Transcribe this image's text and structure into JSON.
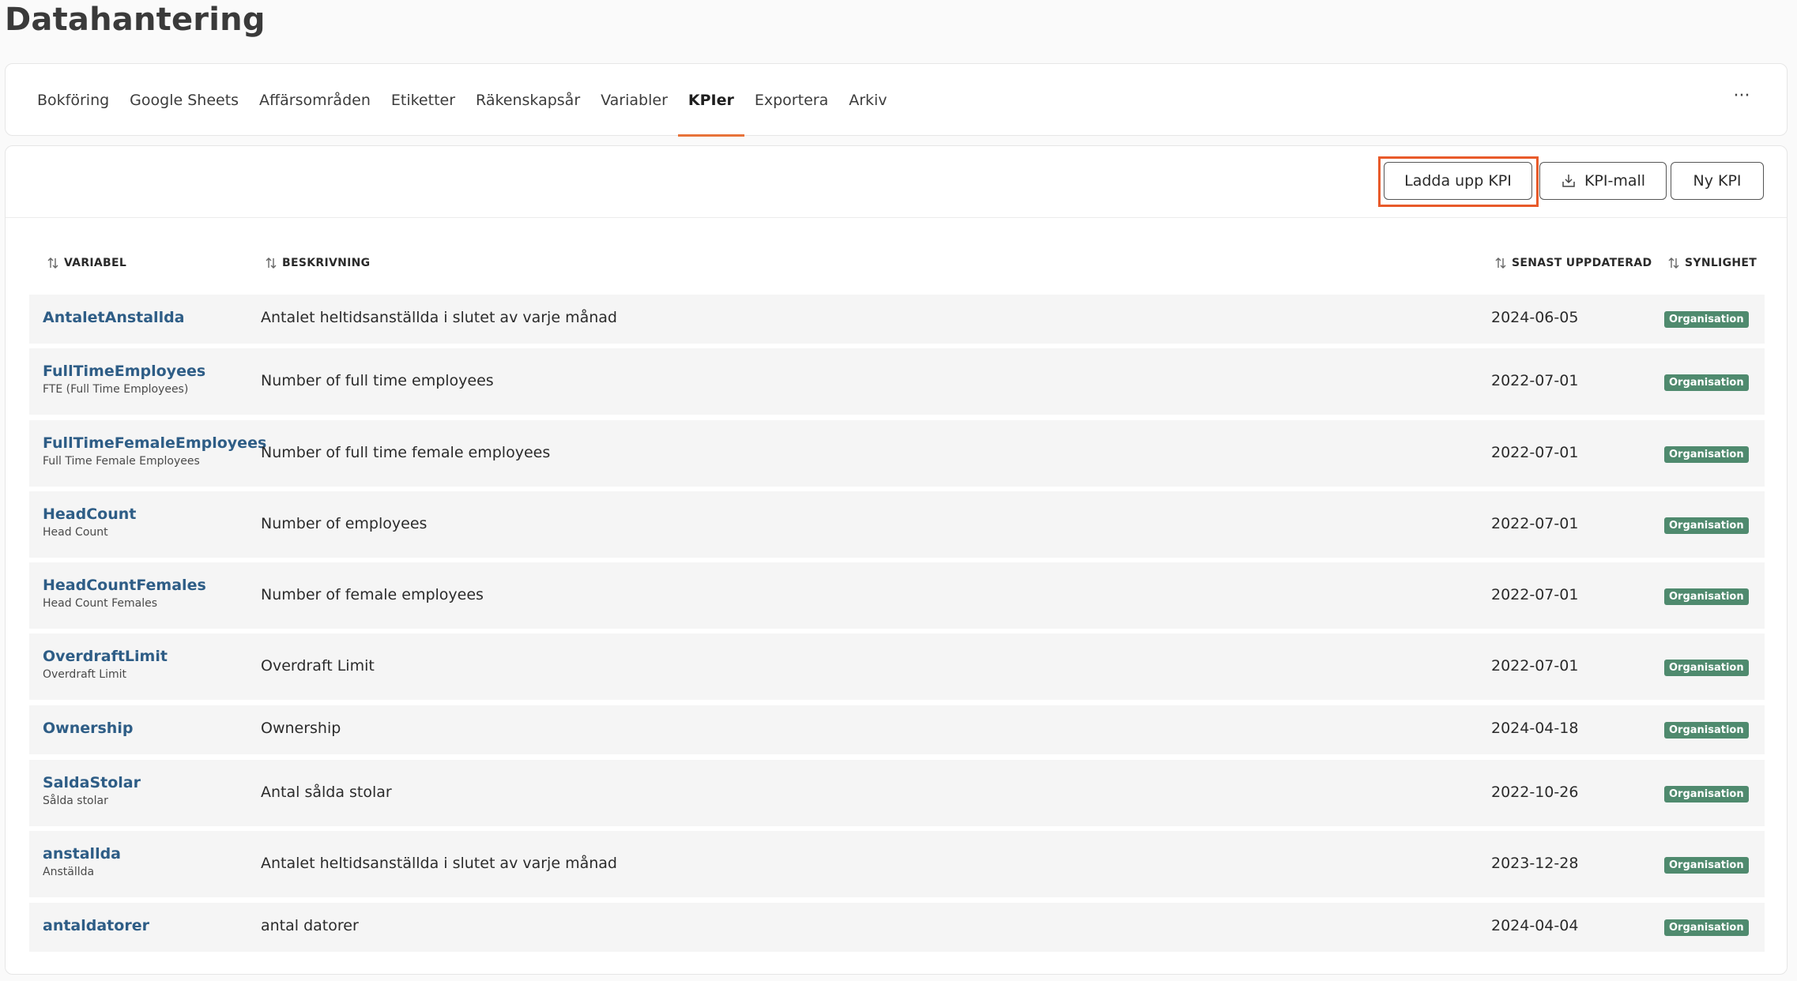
{
  "page": {
    "title": "Datahantering"
  },
  "tabs": [
    {
      "label": "Bokföring"
    },
    {
      "label": "Google Sheets"
    },
    {
      "label": "Affärsområden"
    },
    {
      "label": "Etiketter"
    },
    {
      "label": "Räkenskapsår"
    },
    {
      "label": "Variabler"
    },
    {
      "label": "KPIer",
      "active": true
    },
    {
      "label": "Exportera"
    },
    {
      "label": "Arkiv"
    }
  ],
  "more_label": "···",
  "toolbar": {
    "upload_label": "Ladda upp KPI",
    "template_label": "KPI-mall",
    "template_icon": "download-tray-icon",
    "new_label": "Ny KPI"
  },
  "table": {
    "headers": {
      "variable": "VARIABEL",
      "description": "BESKRIVNING",
      "updated": "SENAST UPPDATERAD",
      "visibility": "SYNLIGHET"
    },
    "rows": [
      {
        "name": "AntaletAnstallda",
        "sub": "",
        "description": "Antalet heltidsanställda i slutet av varje månad",
        "updated": "2024-06-05",
        "visibility": "Organisation"
      },
      {
        "name": "FullTimeEmployees",
        "sub": "FTE (Full Time Employees)",
        "description": "Number of full time employees",
        "updated": "2022-07-01",
        "visibility": "Organisation"
      },
      {
        "name": "FullTimeFemaleEmployees",
        "sub": "Full Time Female Employees",
        "description": "Number of full time female employees",
        "updated": "2022-07-01",
        "visibility": "Organisation"
      },
      {
        "name": "HeadCount",
        "sub": "Head Count",
        "description": "Number of employees",
        "updated": "2022-07-01",
        "visibility": "Organisation"
      },
      {
        "name": "HeadCountFemales",
        "sub": "Head Count Females",
        "description": "Number of female employees",
        "updated": "2022-07-01",
        "visibility": "Organisation"
      },
      {
        "name": "OverdraftLimit",
        "sub": "Overdraft Limit",
        "description": "Overdraft Limit",
        "updated": "2022-07-01",
        "visibility": "Organisation"
      },
      {
        "name": "Ownership",
        "sub": "",
        "description": "Ownership",
        "updated": "2024-04-18",
        "visibility": "Organisation"
      },
      {
        "name": "SaldaStolar",
        "sub": "Sålda stolar",
        "description": "Antal sålda stolar",
        "updated": "2022-10-26",
        "visibility": "Organisation"
      },
      {
        "name": "anstallda",
        "sub": "Anställda",
        "description": "Antalet heltidsanställda i slutet av varje månad",
        "updated": "2023-12-28",
        "visibility": "Organisation"
      },
      {
        "name": "antaldatorer",
        "sub": "",
        "description": "antal datorer",
        "updated": "2024-04-04",
        "visibility": "Organisation"
      }
    ]
  },
  "colors": {
    "accent": "#e8733a",
    "highlight": "#e85a2a",
    "link": "#2e5d86",
    "badge": "#4f8a6e"
  }
}
